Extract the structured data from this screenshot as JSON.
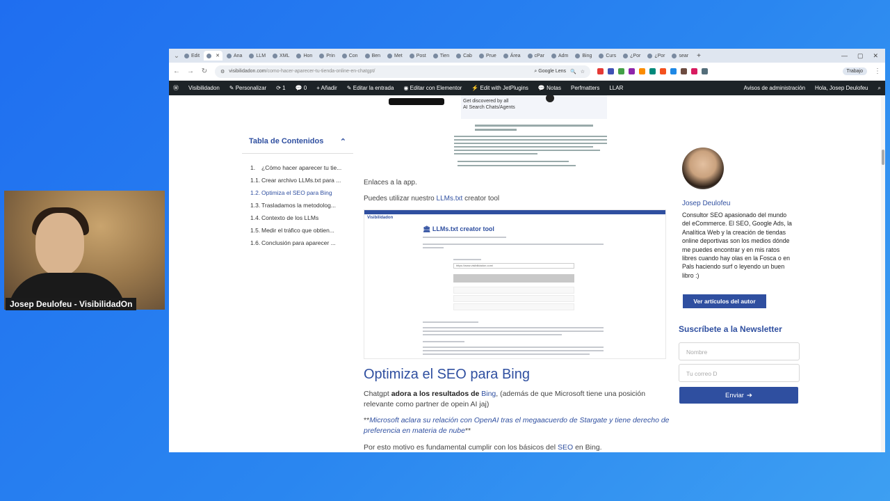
{
  "webcam": {
    "name_label": "Josep Deulofeu - VisibilidadOn"
  },
  "browser": {
    "tabs": [
      "Edit",
      "",
      "Ana",
      "LLM",
      "XML",
      "Hon",
      "Prin",
      "Con",
      "Ben",
      "Met",
      "Post",
      "Tien",
      "Cab",
      "Prue",
      "Área",
      "cPar",
      "Adm",
      "Bing",
      "Curs",
      "¿Por",
      "¿Por",
      "sear"
    ],
    "new_tab_symbol": "+",
    "url_domain": "visibilidadon.com",
    "url_path": "/como-hacer-aparecer-tu-tienda-online-en-chatgpt/",
    "lens_label": "Google Lens",
    "profile_label": "Trabajo"
  },
  "wp_admin_bar": {
    "site": "Visibilidadon",
    "personalize": "Personalizar",
    "updates": "1",
    "comments": "0",
    "add": "Añadir",
    "edit_post": "Editar la entrada",
    "elementor": "Editar con Elementor",
    "jetplugins": "Edit with JetPlugins",
    "notes": "Notas",
    "perfmatters": "Perfmatters",
    "llar": "LLAR",
    "admin_notices": "Avisos de administración",
    "greeting": "Hola, Josep Deulofeu"
  },
  "toc": {
    "title": "Tabla de Contenidos",
    "items": [
      {
        "num": "1.",
        "label": "¿Cómo hacer aparecer tu tie..."
      },
      {
        "num": "1.1.",
        "label": "Crear archivo LLMs.txt para ..."
      },
      {
        "num": "1.2.",
        "label": "Optimiza el SEO para Bing"
      },
      {
        "num": "1.3.",
        "label": "Trasladamos la metodolog..."
      },
      {
        "num": "1.4.",
        "label": "Contexto de los LLMs"
      },
      {
        "num": "1.5.",
        "label": "Medir el tráfico que obtien..."
      },
      {
        "num": "1.6.",
        "label": "Conclusión para aparecer ..."
      }
    ]
  },
  "article": {
    "top_banner_heading": "Get discovered by all AI Search Chats/Agents",
    "app_link": "Enlaces a la app.",
    "tool_prefix": "Puedes utilizar nuestro ",
    "tool_link": "LLMs.txt",
    "tool_suffix": " creator tool",
    "app_logo": "Visibilidadon",
    "app_title": "🏛 LLMs.txt creator tool",
    "app_input_value": "https://www.visibilidadon.com/",
    "h2": "Optimiza el SEO para Bing",
    "p1_a": "Chatgpt ",
    "p1_b": "adora a los resultados de ",
    "p1_link": "Bing",
    "p1_c": ", (además de que Microsoft tiene una posición relevante como partner de opein AI jaj)",
    "p2_stars_open": "**",
    "p2_italic": "Microsoft aclara su relación con OpenAI tras el megaacuerdo de Stargate y tiene derecho de preferencia en materia de nube",
    "p2_stars_close": "**",
    "p3_a": "Por esto motivo es fundamental cumplir con los básicos del ",
    "p3_link": "SEO",
    "p3_b": " en Bing."
  },
  "sidebar": {
    "author_name": "Josep Deulofeu",
    "bio": "Consultor SEO apasionado del mundo del eCommerce. El SEO, Google Ads, la Analítica Web y la creación de tiendas online deportivas son los medios dónde me puedes encontrar y en mis ratos libres cuando hay olas en la Fosca o en Pals haciendo surf o leyendo un buen libro :)",
    "author_button": "Ver artículos del autor",
    "newsletter_title": "Suscríbete a la Newsletter",
    "name_placeholder": "Nombre",
    "email_placeholder": "Tu correo D",
    "send_label": "Enviar",
    "send_arrow": "➔"
  },
  "colors": {
    "accent": "#2f4fa0",
    "wpbar": "#1d2327",
    "desktop": "#2a86f0"
  }
}
